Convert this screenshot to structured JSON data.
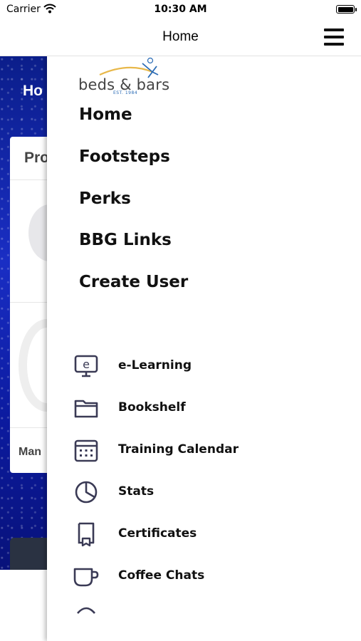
{
  "status_bar": {
    "carrier": "Carrier",
    "time": "10:30 AM"
  },
  "navbar": {
    "title": "Home"
  },
  "background": {
    "title": "Ho",
    "card_title": "Pro",
    "card_footer": "Man"
  },
  "logo": {
    "text": "beds & bars",
    "est": "EST. 1984"
  },
  "menu": {
    "main_items": [
      {
        "label": "Home"
      },
      {
        "label": "Footsteps"
      },
      {
        "label": "Perks"
      },
      {
        "label": "BBG Links"
      },
      {
        "label": "Create User"
      }
    ],
    "sub_items": [
      {
        "label": "e-Learning",
        "icon": "e-learning-icon"
      },
      {
        "label": "Bookshelf",
        "icon": "folder-icon"
      },
      {
        "label": "Training Calendar",
        "icon": "calendar-icon"
      },
      {
        "label": "Stats",
        "icon": "pie-chart-icon"
      },
      {
        "label": "Certificates",
        "icon": "certificate-icon"
      },
      {
        "label": "Coffee Chats",
        "icon": "coffee-cup-icon"
      }
    ]
  },
  "colors": {
    "icon_stroke": "#3a3a55",
    "background_blue": "#1a2ec4",
    "logo_blue": "#2a6bb5",
    "logo_gold": "#e8b84a"
  }
}
